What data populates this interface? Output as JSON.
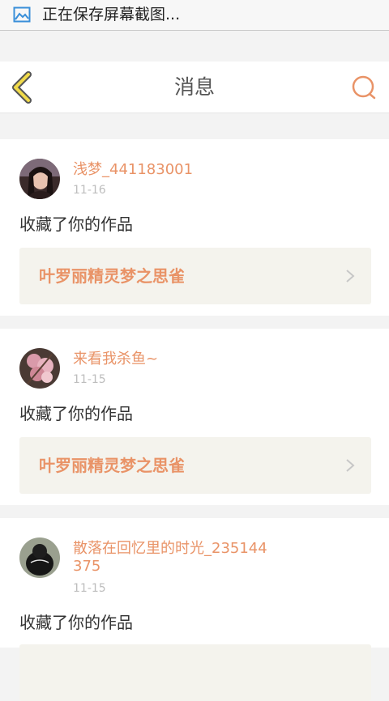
{
  "status_bar": {
    "notification_text": "正在保存屏幕截图...",
    "icon": "image-icon"
  },
  "nav": {
    "title": "消息",
    "back_icon": "chevron-left-icon",
    "search_icon": "search-icon"
  },
  "colors": {
    "accent": "#e99367",
    "back_icon": "#f0da4a",
    "work_box_bg": "#f4f3ed"
  },
  "messages": [
    {
      "username": "浅梦_441183001",
      "date": "11-16",
      "action": "收藏了你的作品",
      "work_title": "叶罗丽精灵梦之思雀"
    },
    {
      "username": "来看我杀鱼~",
      "date": "11-15",
      "action": "收藏了你的作品",
      "work_title": "叶罗丽精灵梦之思雀"
    },
    {
      "username": "散落在回忆里的时光_235144375",
      "date": "11-15",
      "action": "收藏了你的作品",
      "work_title": ""
    }
  ]
}
